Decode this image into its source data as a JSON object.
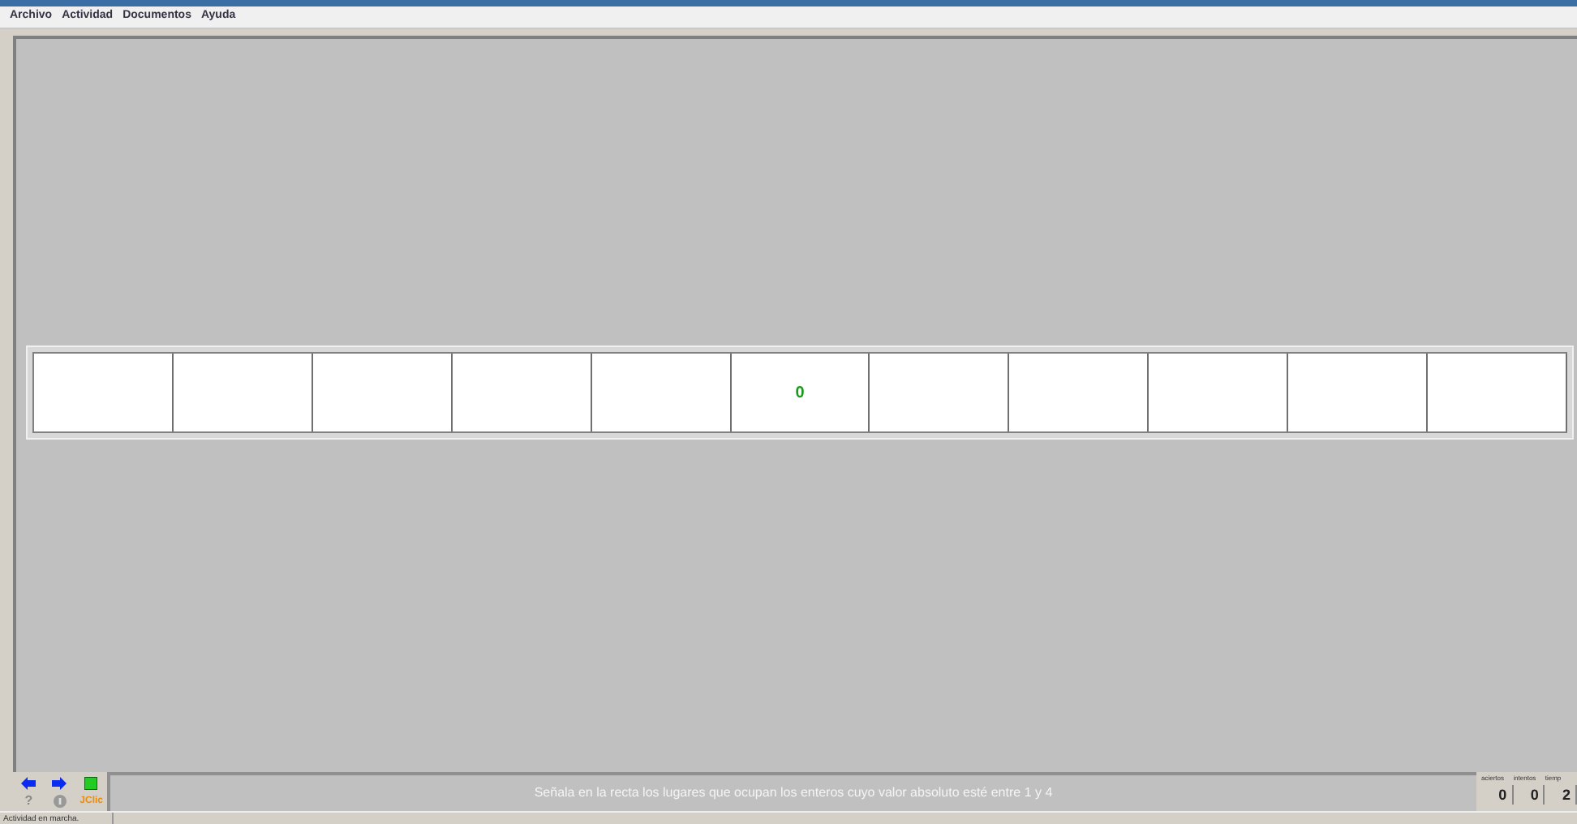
{
  "menu": [
    "Archivo",
    "Actividad",
    "Documentos",
    "Ayuda"
  ],
  "number_line": {
    "cells": [
      {
        "kind": "blank"
      },
      {
        "kind": "blank"
      },
      {
        "kind": "blank"
      },
      {
        "kind": "blank"
      },
      {
        "kind": "blank"
      },
      {
        "kind": "number",
        "label": "0"
      },
      {
        "kind": "blank"
      },
      {
        "kind": "blank"
      },
      {
        "kind": "blank"
      },
      {
        "kind": "blank"
      },
      {
        "kind": "blank"
      }
    ]
  },
  "instruction": "Señala en la recta los lugares que ocupan los enteros cuyo valor absoluto esté entre 1 y 4",
  "help_button": "?",
  "reports_button": "JClic",
  "counters": [
    {
      "label": "aciertos",
      "value": "0"
    },
    {
      "label": "intentos",
      "value": "0"
    },
    {
      "label": "tiemp",
      "value": "2"
    }
  ],
  "status_bar": "Actividad en marcha."
}
